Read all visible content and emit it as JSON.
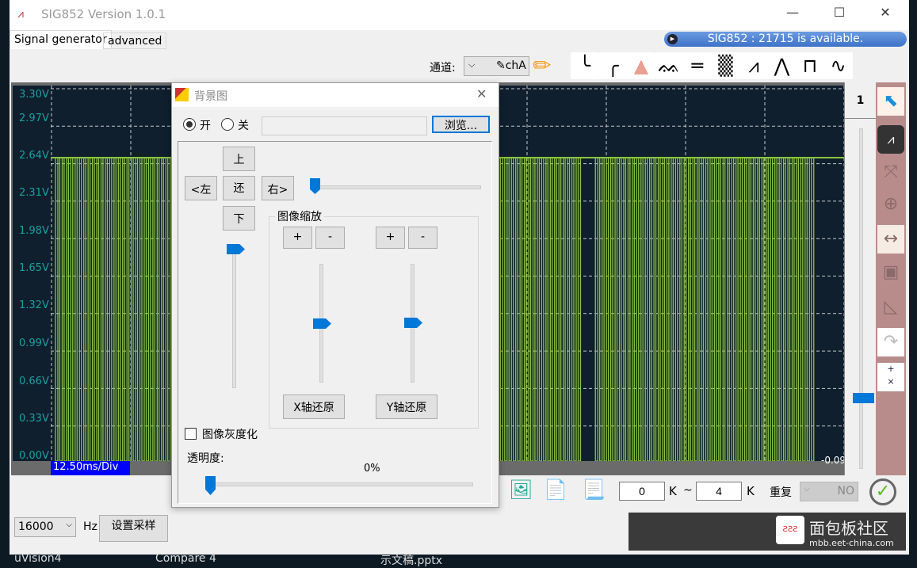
{
  "window": {
    "title": "SIG852  Version 1.0.1",
    "minimize": "—",
    "maximize": "☐",
    "close": "✕"
  },
  "tabs": [
    {
      "label": "Signal generator",
      "active": true
    },
    {
      "label": "advanced",
      "active": false
    }
  ],
  "status": "SIG852 : 21715 is available.",
  "toolbar": {
    "channel_label": "通道:",
    "channel_value": "chA",
    "waveforms": [
      "exponential-decay-icon",
      "exponential-rise-icon",
      "gaussian-icon",
      "sinc-icon",
      "dc-icon",
      "noise-icon",
      "sawtooth-icon",
      "triangle-icon",
      "square-icon",
      "sine-icon"
    ]
  },
  "scope": {
    "y_labels": [
      "3.30V",
      "2.97V",
      "2.64V",
      "2.31V",
      "1.98V",
      "1.65V",
      "1.32V",
      "0.99V",
      "0.66V",
      "0.33V",
      "0.00V"
    ],
    "time_div": "12.50ms/Div",
    "right_readout": "-0.09",
    "channel_number": "1",
    "trace_color": "#8bc53f"
  },
  "dialog": {
    "title": "背景图",
    "radio_on": "开",
    "radio_off": "关",
    "on_selected": true,
    "path_value": "",
    "browse": "浏览...",
    "up": "上",
    "reset": "还",
    "left": "<左",
    "right": "右>",
    "down": "下",
    "zoom_group": "图像缩放",
    "x_plus": "+",
    "x_minus": "-",
    "y_plus": "+",
    "y_minus": "-",
    "x_reset": "X轴还原",
    "y_reset": "Y轴还原",
    "grayscale": "图像灰度化",
    "grayscale_checked": false,
    "opacity_label": "透明度:",
    "opacity_value": "0%",
    "opacity": 0
  },
  "bottom": {
    "range_from": "0",
    "range_to": "4",
    "unit1": "K",
    "tilde": "~",
    "unit2": "K",
    "repeat_label": "重复",
    "repeat_value": "NO",
    "sample_rate": "16000",
    "hz": "Hz",
    "set_sample": "设置采样"
  },
  "taskbar": [
    "uVision4",
    "Compare 4",
    "示文稿.pptx"
  ],
  "watermark": {
    "text": "面包板社区",
    "url": "mbb.eet-china.com"
  }
}
